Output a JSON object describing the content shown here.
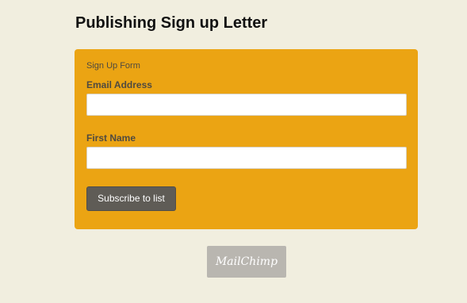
{
  "page": {
    "title": "Publishing Sign up Letter"
  },
  "form": {
    "caption": "Sign Up Form",
    "email": {
      "label": "Email Address",
      "value": "",
      "placeholder": ""
    },
    "first_name": {
      "label": "First Name",
      "value": "",
      "placeholder": ""
    },
    "submit_label": "Subscribe to list"
  },
  "badge": {
    "text": "MailChimp"
  },
  "colors": {
    "background": "#f1eedf",
    "panel": "#eba413",
    "button": "#5f5c56",
    "badge": "#b9b6b0"
  }
}
